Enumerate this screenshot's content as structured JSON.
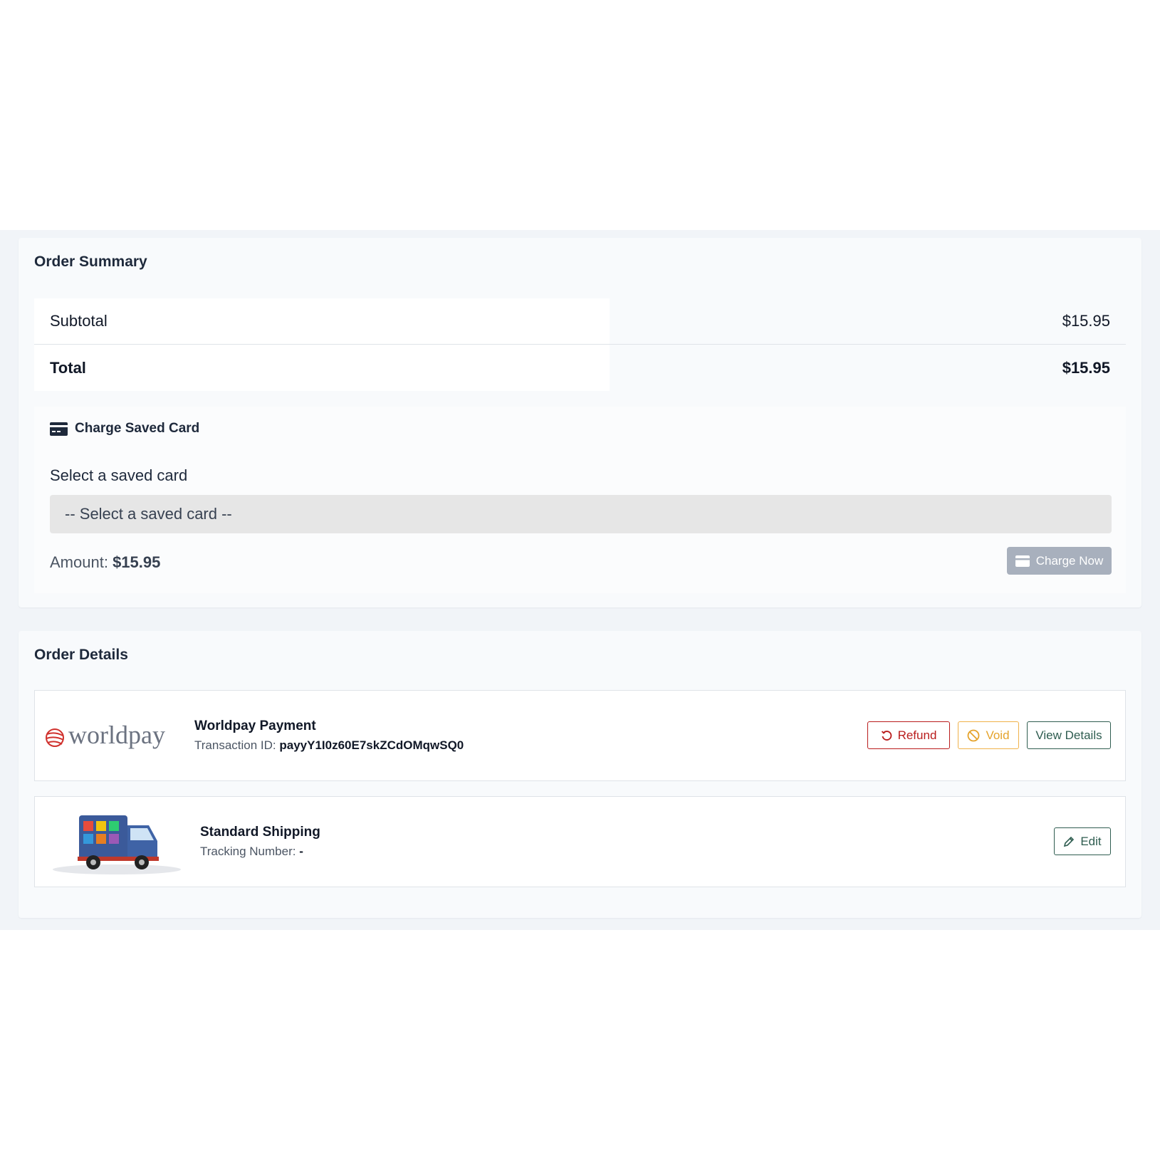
{
  "order_summary": {
    "title": "Order Summary",
    "rows": [
      {
        "label": "Subtotal",
        "value": "$15.95"
      },
      {
        "label": "Total",
        "value": "$15.95"
      }
    ],
    "charge_saved_card": {
      "title": "Charge Saved Card",
      "icon": "credit-card-icon",
      "select_label": "Select a saved card",
      "select_value": "-- Select a saved card --",
      "amount_label": "Amount:",
      "amount_value": "$15.95",
      "button_label": "Charge Now"
    }
  },
  "order_details": {
    "title": "Order Details",
    "payment": {
      "logo_text": "worldpay",
      "title": "Worldpay Payment",
      "sub_label": "Transaction ID:",
      "sub_value": "payyY1I0z60E7skZCdOMqwSQ0",
      "buttons": {
        "refund": "Refund",
        "void": "Void",
        "view": "View Details"
      }
    },
    "shipping": {
      "title": "Standard Shipping",
      "sub_label": "Tracking Number:",
      "sub_value": "-",
      "edit_label": "Edit"
    }
  },
  "colors": {
    "band": "#f1f4f8",
    "refund": "#b91c1c",
    "void": "#e5a32c",
    "outline": "#2f5d50",
    "charge_btn": "#a8b0bd",
    "worldpay_red": "#d0312d"
  }
}
